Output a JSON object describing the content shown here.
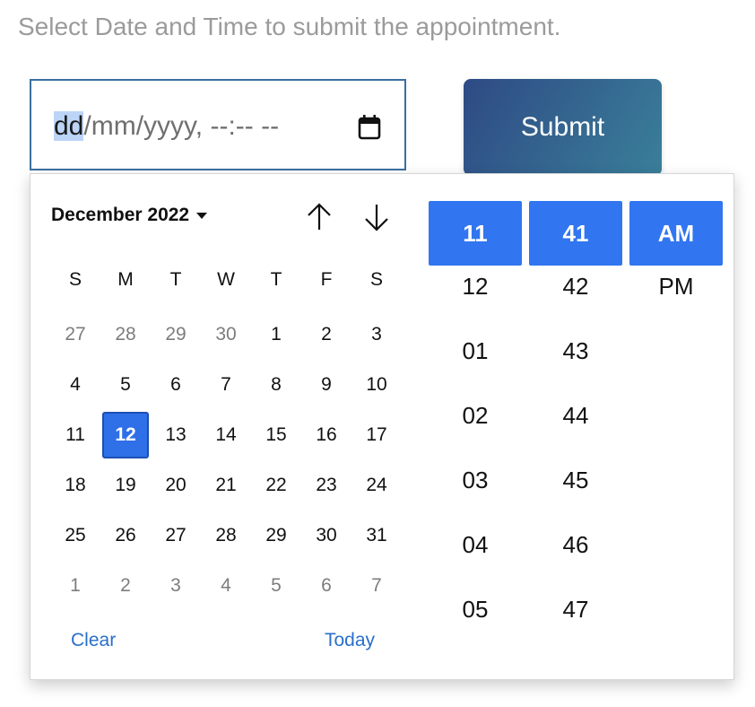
{
  "instruction": "Select Date and Time to submit the appointment.",
  "input": {
    "active_segment": "dd",
    "rest_text": "/mm/yyyy, --:-- --"
  },
  "submit_label": "Submit",
  "picker": {
    "month_label": "December 2022",
    "weekdays": [
      "S",
      "M",
      "T",
      "W",
      "T",
      "F",
      "S"
    ],
    "days": [
      {
        "d": "27",
        "muted": true
      },
      {
        "d": "28",
        "muted": true
      },
      {
        "d": "29",
        "muted": true
      },
      {
        "d": "30",
        "muted": true
      },
      {
        "d": "1"
      },
      {
        "d": "2"
      },
      {
        "d": "3"
      },
      {
        "d": "4"
      },
      {
        "d": "5"
      },
      {
        "d": "6"
      },
      {
        "d": "7"
      },
      {
        "d": "8"
      },
      {
        "d": "9"
      },
      {
        "d": "10"
      },
      {
        "d": "11"
      },
      {
        "d": "12",
        "selected": true
      },
      {
        "d": "13"
      },
      {
        "d": "14"
      },
      {
        "d": "15"
      },
      {
        "d": "16"
      },
      {
        "d": "17"
      },
      {
        "d": "18"
      },
      {
        "d": "19"
      },
      {
        "d": "20"
      },
      {
        "d": "21"
      },
      {
        "d": "22"
      },
      {
        "d": "23"
      },
      {
        "d": "24"
      },
      {
        "d": "25"
      },
      {
        "d": "26"
      },
      {
        "d": "27"
      },
      {
        "d": "28"
      },
      {
        "d": "29"
      },
      {
        "d": "30"
      },
      {
        "d": "31"
      },
      {
        "d": "1",
        "muted": true
      },
      {
        "d": "2",
        "muted": true
      },
      {
        "d": "3",
        "muted": true
      },
      {
        "d": "4",
        "muted": true
      },
      {
        "d": "5",
        "muted": true
      },
      {
        "d": "6",
        "muted": true
      },
      {
        "d": "7",
        "muted": true
      }
    ],
    "clear_label": "Clear",
    "today_label": "Today",
    "hours": [
      "11",
      "12",
      "01",
      "02",
      "03",
      "04",
      "05"
    ],
    "minutes": [
      "41",
      "42",
      "43",
      "44",
      "45",
      "46",
      "47"
    ],
    "periods": [
      "AM",
      "PM"
    ],
    "selected_hour": "11",
    "selected_minute": "41",
    "selected_period": "AM"
  },
  "colors": {
    "accent": "#3176f0",
    "link": "#2a6fc9",
    "submit_gradient_start": "#2e4a84",
    "submit_gradient_end": "#3a7f9a"
  },
  "icons": {
    "input": "calendar-icon",
    "nav_up": "arrow-up-icon",
    "nav_down": "arrow-down-icon",
    "month_dropdown": "caret-down-icon"
  }
}
